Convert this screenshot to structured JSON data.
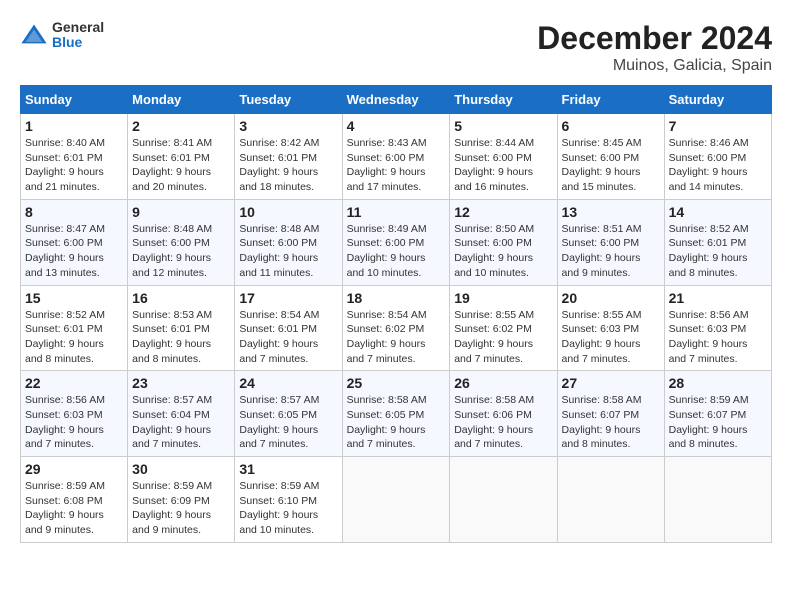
{
  "header": {
    "logo": {
      "general": "General",
      "blue": "Blue"
    },
    "title": "December 2024",
    "subtitle": "Muinos, Galicia, Spain"
  },
  "calendar": {
    "days_of_week": [
      "Sunday",
      "Monday",
      "Tuesday",
      "Wednesday",
      "Thursday",
      "Friday",
      "Saturday"
    ],
    "weeks": [
      [
        null,
        null,
        null,
        null,
        null,
        null,
        null
      ]
    ]
  },
  "days": {
    "1": {
      "num": "1",
      "sunrise": "8:40 AM",
      "sunset": "6:01 PM",
      "daylight_hours": "9",
      "daylight_minutes": "21"
    },
    "2": {
      "num": "2",
      "sunrise": "8:41 AM",
      "sunset": "6:01 PM",
      "daylight_hours": "9",
      "daylight_minutes": "20"
    },
    "3": {
      "num": "3",
      "sunrise": "8:42 AM",
      "sunset": "6:01 PM",
      "daylight_hours": "9",
      "daylight_minutes": "18"
    },
    "4": {
      "num": "4",
      "sunrise": "8:43 AM",
      "sunset": "6:00 PM",
      "daylight_hours": "9",
      "daylight_minutes": "17"
    },
    "5": {
      "num": "5",
      "sunrise": "8:44 AM",
      "sunset": "6:00 PM",
      "daylight_hours": "9",
      "daylight_minutes": "16"
    },
    "6": {
      "num": "6",
      "sunrise": "8:45 AM",
      "sunset": "6:00 PM",
      "daylight_hours": "9",
      "daylight_minutes": "15"
    },
    "7": {
      "num": "7",
      "sunrise": "8:46 AM",
      "sunset": "6:00 PM",
      "daylight_hours": "9",
      "daylight_minutes": "14"
    },
    "8": {
      "num": "8",
      "sunrise": "8:47 AM",
      "sunset": "6:00 PM",
      "daylight_hours": "9",
      "daylight_minutes": "13"
    },
    "9": {
      "num": "9",
      "sunrise": "8:48 AM",
      "sunset": "6:00 PM",
      "daylight_hours": "9",
      "daylight_minutes": "12"
    },
    "10": {
      "num": "10",
      "sunrise": "8:48 AM",
      "sunset": "6:00 PM",
      "daylight_hours": "9",
      "daylight_minutes": "11"
    },
    "11": {
      "num": "11",
      "sunrise": "8:49 AM",
      "sunset": "6:00 PM",
      "daylight_hours": "9",
      "daylight_minutes": "10"
    },
    "12": {
      "num": "12",
      "sunrise": "8:50 AM",
      "sunset": "6:00 PM",
      "daylight_hours": "9",
      "daylight_minutes": "10"
    },
    "13": {
      "num": "13",
      "sunrise": "8:51 AM",
      "sunset": "6:00 PM",
      "daylight_hours": "9",
      "daylight_minutes": "9"
    },
    "14": {
      "num": "14",
      "sunrise": "8:52 AM",
      "sunset": "6:01 PM",
      "daylight_hours": "9",
      "daylight_minutes": "8"
    },
    "15": {
      "num": "15",
      "sunrise": "8:52 AM",
      "sunset": "6:01 PM",
      "daylight_hours": "9",
      "daylight_minutes": "8"
    },
    "16": {
      "num": "16",
      "sunrise": "8:53 AM",
      "sunset": "6:01 PM",
      "daylight_hours": "9",
      "daylight_minutes": "8"
    },
    "17": {
      "num": "17",
      "sunrise": "8:54 AM",
      "sunset": "6:01 PM",
      "daylight_hours": "9",
      "daylight_minutes": "7"
    },
    "18": {
      "num": "18",
      "sunrise": "8:54 AM",
      "sunset": "6:02 PM",
      "daylight_hours": "9",
      "daylight_minutes": "7"
    },
    "19": {
      "num": "19",
      "sunrise": "8:55 AM",
      "sunset": "6:02 PM",
      "daylight_hours": "9",
      "daylight_minutes": "7"
    },
    "20": {
      "num": "20",
      "sunrise": "8:55 AM",
      "sunset": "6:03 PM",
      "daylight_hours": "9",
      "daylight_minutes": "7"
    },
    "21": {
      "num": "21",
      "sunrise": "8:56 AM",
      "sunset": "6:03 PM",
      "daylight_hours": "9",
      "daylight_minutes": "7"
    },
    "22": {
      "num": "22",
      "sunrise": "8:56 AM",
      "sunset": "6:03 PM",
      "daylight_hours": "9",
      "daylight_minutes": "7"
    },
    "23": {
      "num": "23",
      "sunrise": "8:57 AM",
      "sunset": "6:04 PM",
      "daylight_hours": "9",
      "daylight_minutes": "7"
    },
    "24": {
      "num": "24",
      "sunrise": "8:57 AM",
      "sunset": "6:05 PM",
      "daylight_hours": "9",
      "daylight_minutes": "7"
    },
    "25": {
      "num": "25",
      "sunrise": "8:58 AM",
      "sunset": "6:05 PM",
      "daylight_hours": "9",
      "daylight_minutes": "7"
    },
    "26": {
      "num": "26",
      "sunrise": "8:58 AM",
      "sunset": "6:06 PM",
      "daylight_hours": "9",
      "daylight_minutes": "7"
    },
    "27": {
      "num": "27",
      "sunrise": "8:58 AM",
      "sunset": "6:07 PM",
      "daylight_hours": "9",
      "daylight_minutes": "8"
    },
    "28": {
      "num": "28",
      "sunrise": "8:59 AM",
      "sunset": "6:07 PM",
      "daylight_hours": "9",
      "daylight_minutes": "8"
    },
    "29": {
      "num": "29",
      "sunrise": "8:59 AM",
      "sunset": "6:08 PM",
      "daylight_hours": "9",
      "daylight_minutes": "9"
    },
    "30": {
      "num": "30",
      "sunrise": "8:59 AM",
      "sunset": "6:09 PM",
      "daylight_hours": "9",
      "daylight_minutes": "9"
    },
    "31": {
      "num": "31",
      "sunrise": "8:59 AM",
      "sunset": "6:10 PM",
      "daylight_hours": "9",
      "daylight_minutes": "10"
    }
  },
  "labels": {
    "sunrise": "Sunrise:",
    "sunset": "Sunset:",
    "daylight": "Daylight:",
    "hours": "hours",
    "and": "and",
    "minutes": "minutes."
  }
}
